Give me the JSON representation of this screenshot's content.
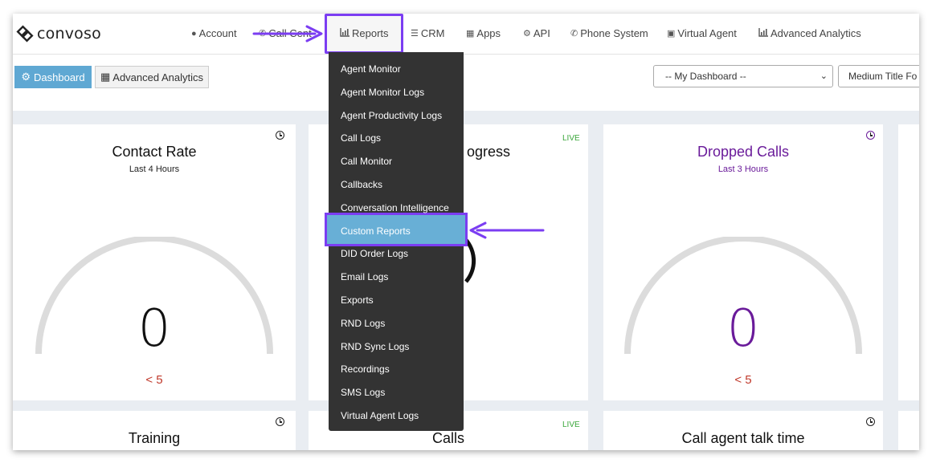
{
  "app": {
    "logo_text": "convoso"
  },
  "nav": {
    "account": "Account",
    "call_center": "Call Cent",
    "reports": "Reports",
    "crm": "CRM",
    "apps": "Apps",
    "api": "API",
    "phone_system": "Phone System",
    "virtual_agent": "Virtual Agent",
    "advanced_analytics": "Advanced Analytics"
  },
  "toolbar": {
    "dashboard_label": "Dashboard",
    "advanced_analytics_label": "Advanced Analytics",
    "dashboard_select": "-- My Dashboard --",
    "font_select": "Medium Title Fo"
  },
  "reports_menu": {
    "items": [
      "Agent Monitor",
      "Agent Monitor Logs",
      "Agent Productivity Logs",
      "Call Logs",
      "Call Monitor",
      "Callbacks",
      "Conversation Intelligence",
      "Custom Reports",
      "DID Order Logs",
      "Email Logs",
      "Exports",
      "RND Logs",
      "RND Sync Logs",
      "Recordings",
      "SMS Logs",
      "Virtual Agent Logs"
    ],
    "highlighted": "Custom Reports"
  },
  "cards": {
    "contact_rate": {
      "title": "Contact Rate",
      "subtitle": "Last 4 Hours",
      "value": "0",
      "threshold": "< 5"
    },
    "in_progress": {
      "title_partial": "ogress",
      "badge": "LIVE"
    },
    "dropped_calls": {
      "title": "Dropped Calls",
      "subtitle": "Last 3 Hours",
      "value": "0",
      "threshold": "< 5"
    },
    "training": {
      "title": "Training"
    },
    "calls": {
      "title": "Calls",
      "badge": "LIVE"
    },
    "talk_time": {
      "title": "Call agent talk time"
    }
  },
  "colors": {
    "accent_purple": "#7b3df2",
    "dropped_purple": "#6a1b9a",
    "dashboard_blue": "#5fa8d3",
    "threshold_red": "#c0392b",
    "live_green": "#3aa63a"
  }
}
